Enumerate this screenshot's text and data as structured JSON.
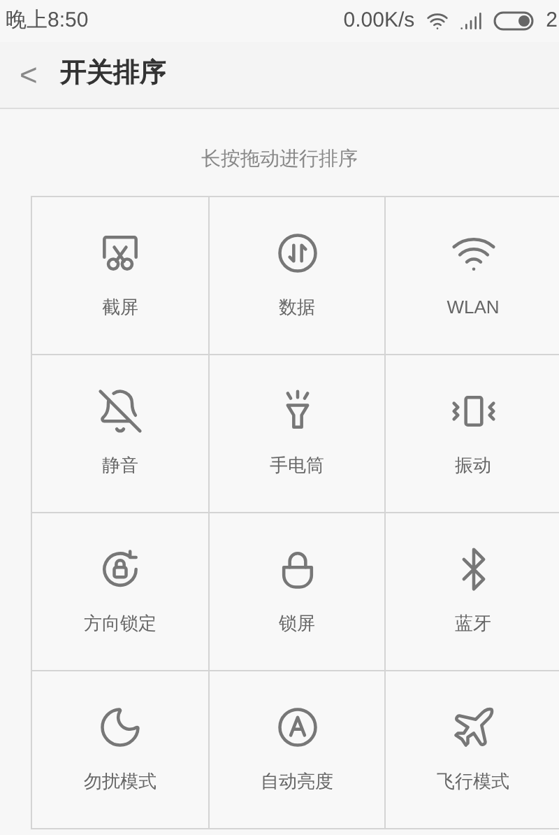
{
  "status_bar": {
    "time": "晚上8:50",
    "speed": "0.00K/s",
    "battery": "2"
  },
  "header": {
    "back": "<",
    "title": "开关排序"
  },
  "hint": "长按拖动进行排序",
  "tiles": [
    {
      "kind": "screenshot",
      "label": "截屏"
    },
    {
      "kind": "data",
      "label": "数据"
    },
    {
      "kind": "wifi",
      "label": "WLAN"
    },
    {
      "kind": "mute",
      "label": "静音"
    },
    {
      "kind": "flashlight",
      "label": "手电筒"
    },
    {
      "kind": "vibrate",
      "label": "振动"
    },
    {
      "kind": "rotation",
      "label": "方向锁定"
    },
    {
      "kind": "lock",
      "label": "锁屏"
    },
    {
      "kind": "bluetooth",
      "label": "蓝牙"
    },
    {
      "kind": "dnd",
      "label": "勿扰模式"
    },
    {
      "kind": "brightness",
      "label": "自动亮度"
    },
    {
      "kind": "airplane",
      "label": "飞行模式"
    }
  ]
}
